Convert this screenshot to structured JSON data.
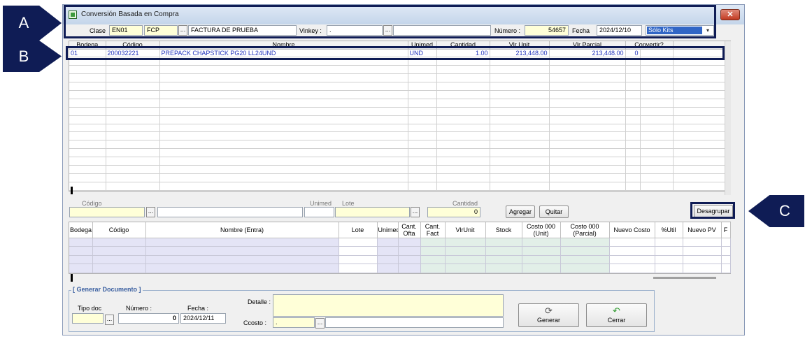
{
  "callouts": {
    "a": "A",
    "b": "B",
    "c": "C"
  },
  "window": {
    "title": "Conversión Basada en Compra",
    "close_glyph": "✕"
  },
  "header": {
    "clase_label": "Clase",
    "clase_code": "EN01",
    "clase_type": "FCP",
    "clase_desc": "FACTURA DE PRUEBA",
    "vinkey_label": "Vinkey :",
    "vinkey_value": ".",
    "vinkey_desc": "",
    "numero_label": "Número :",
    "numero_value": "54657",
    "fecha_label": "Fecha",
    "fecha_value": "2024/12/10",
    "filter_selected": "Sólo Kits",
    "ellipsis": "..."
  },
  "grid1": {
    "columns": [
      "Bodega",
      "Código",
      "Nombre",
      "Unimed",
      "Cantidad",
      "Vlr Unit",
      "Vlr Parcial",
      "Convertir?"
    ],
    "rows": [
      {
        "bodega": "01",
        "codigo": "200032221",
        "nombre": "PREPACK CHAPSTICK PG20 LL24UND",
        "unimed": "UND",
        "cantidad": "1.00",
        "vlr_unit": "213,448.00",
        "vlr_parcial": "213,448.00",
        "convertir": "0"
      }
    ]
  },
  "entry": {
    "codigo_label": "Código",
    "unimed_label": "Unimed",
    "lote_label": "Lote",
    "cantidad_label": "Cantidad",
    "cantidad_value": "0",
    "agregar": "Agregar",
    "quitar": "Quitar",
    "desagrupar": "Desagrupar"
  },
  "grid2": {
    "columns": [
      "Bodega",
      "Código",
      "Nombre (Entra)",
      "Lote",
      "Unimed",
      "Cant. Ofta",
      "Cant. Fact",
      "VlrUnit",
      "Stock",
      "Costo 000 (Unit)",
      "Costo 000 (Parcial)",
      "Nuevo Costo",
      "%Util",
      "Nuevo PV",
      "F"
    ]
  },
  "generar": {
    "group_title": "[ Generar Documento ]",
    "tipo_doc_label": "Tipo doc",
    "numero_label": "Número :",
    "numero_value": "0",
    "fecha_label": "Fecha :",
    "fecha_value": "2024/12/11",
    "detalle_label": "Detalle :",
    "ccosto_label": "Ccosto :",
    "ccosto_value": ".",
    "generar_button": "Generar",
    "cerrar_button": "Cerrar"
  },
  "colors": {
    "callout": "#0f1c55",
    "selection": "#3166c6",
    "row_text": "#2233bb",
    "yellow_field": "#ffffd8"
  }
}
